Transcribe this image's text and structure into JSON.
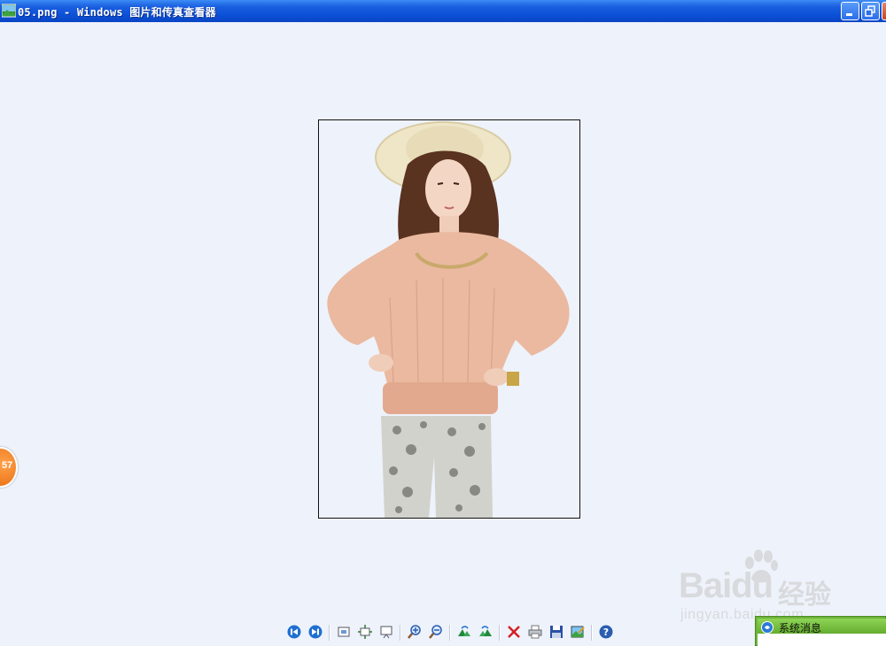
{
  "window": {
    "title": "05.png - Windows 图片和传真查看器",
    "controls": [
      "minimize-icon",
      "restore-icon",
      "close-icon"
    ]
  },
  "float_badge": {
    "text": "57"
  },
  "watermark": {
    "brand": "Baidu",
    "brand_cn": "经验",
    "url": "jingyan.baidu.com"
  },
  "toolbar": {
    "buttons": [
      "previous-image-icon",
      "next-image-icon",
      "best-fit-icon",
      "actual-size-icon",
      "slideshow-icon",
      "zoom-in-icon",
      "zoom-out-icon",
      "rotate-clockwise-icon",
      "rotate-counterclockwise-icon",
      "delete-icon",
      "print-icon",
      "save-icon",
      "open-with-icon",
      "help-icon"
    ]
  },
  "system_message": {
    "title": "系统消息"
  },
  "colors": {
    "titlebar": "#0b4fd6",
    "background": "#eef2fb",
    "popup_green": "#6fb33a"
  }
}
